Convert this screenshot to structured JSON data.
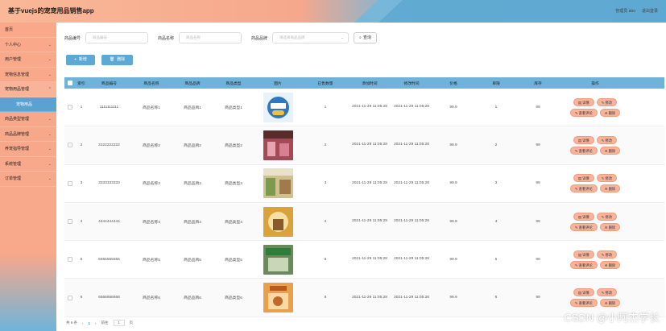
{
  "header": {
    "title": "基于vuejs的宠宠用品销售app",
    "user_label": "管理员 abo",
    "logout_label": "退出登录"
  },
  "sidebar": {
    "items": [
      {
        "label": "首页",
        "arrow": false
      },
      {
        "label": "个人中心",
        "arrow": true
      },
      {
        "label": "用户管理",
        "arrow": true
      },
      {
        "label": "宠物信息管理",
        "arrow": true
      },
      {
        "label": "宠物用品管理",
        "arrow": true
      },
      {
        "label": "宠物用品",
        "sub": true
      },
      {
        "label": "商品类型管理",
        "arrow": true
      },
      {
        "label": "商品品牌管理",
        "arrow": true
      },
      {
        "label": "养宠指导管理",
        "arrow": true
      },
      {
        "label": "系统管理",
        "arrow": true
      },
      {
        "label": "订单管理",
        "arrow": true
      }
    ]
  },
  "search": {
    "field1_label": "商品编号",
    "field1_placeholder": "商品编号",
    "field2_label": "商品名称",
    "field2_placeholder": "商品名称",
    "field3_label": "商品品牌",
    "field3_placeholder": "请选择商品品牌",
    "query_label": "查询"
  },
  "actions": {
    "add_label": "新增",
    "delete_label": "删除"
  },
  "table": {
    "headers": [
      "索引",
      "商品编号",
      "商品名称",
      "商品品牌",
      "商品类型",
      "图片",
      "已售数量",
      "添加时间",
      "修改时间",
      "价格",
      "单限",
      "库存",
      "操作"
    ],
    "rows": [
      {
        "idx": "1",
        "num": "1111111111",
        "name": "商品名称1",
        "brand": "商品品牌1",
        "type": "商品类型1",
        "sold": "1",
        "add": "2021-11-29 11:05:28",
        "up": "2021-11-29 11:05:28",
        "price": "99.9",
        "order": "1",
        "stock": "99",
        "thumb": "shop-logo"
      },
      {
        "idx": "2",
        "num": "2222222222",
        "name": "商品名称2",
        "brand": "商品品牌2",
        "type": "商品类型2",
        "sold": "2",
        "add": "2021-11-29 11:05:28",
        "up": "2021-11-29 11:05:28",
        "price": "99.9",
        "order": "2",
        "stock": "99",
        "thumb": "pink-store"
      },
      {
        "idx": "3",
        "num": "3333333333",
        "name": "商品名称3",
        "brand": "商品品牌3",
        "type": "商品类型3",
        "sold": "3",
        "add": "2021-11-29 11:05:28",
        "up": "2021-11-29 11:05:28",
        "price": "99.9",
        "order": "3",
        "stock": "99",
        "thumb": "green-store"
      },
      {
        "idx": "4",
        "num": "4444444444",
        "name": "商品名称4",
        "brand": "商品品牌4",
        "type": "商品类型4",
        "sold": "4",
        "add": "2021-11-29 11:05:28",
        "up": "2021-11-29 11:05:28",
        "price": "99.9",
        "order": "4",
        "stock": "99",
        "thumb": "yellow-store"
      },
      {
        "idx": "5",
        "num": "5555555555",
        "name": "商品名称5",
        "brand": "商品品牌5",
        "type": "商品类型5",
        "sold": "5",
        "add": "2021-11-29 11:05:28",
        "up": "2021-11-29 11:05:28",
        "price": "99.9",
        "order": "5",
        "stock": "99",
        "thumb": "green-sign"
      },
      {
        "idx": "6",
        "num": "6666666666",
        "name": "商品名称6",
        "brand": "商品品牌6",
        "type": "商品类型6",
        "sold": "6",
        "add": "2021-11-29 11:05:28",
        "up": "2021-11-29 11:05:28",
        "price": "99.9",
        "order": "6",
        "stock": "99",
        "thumb": "orange-poster"
      }
    ],
    "ops": {
      "detail": "详情",
      "edit": "修改",
      "reviews": "查看评论",
      "delete": "删除"
    }
  },
  "pager": {
    "total": "共 6 条",
    "prev": "‹",
    "page": "1",
    "next": "›",
    "goto": "前往",
    "page_input": "1",
    "page_unit": "页"
  },
  "watermark": "CSDN @小阿杰学长",
  "colors": {
    "accent": "#5da9d4",
    "salmon": "#f7b49a",
    "header_left": "#f9b898",
    "header_right": "#5ea9d2"
  }
}
